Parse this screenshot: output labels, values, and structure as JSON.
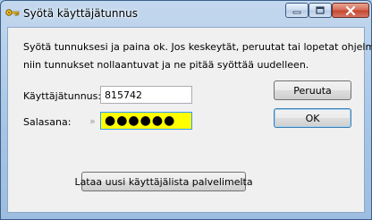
{
  "window": {
    "title": "Syötä käyttäjätunnus",
    "icon": "key-icon",
    "controls": {
      "minimize": "minimize-icon",
      "maximize": "maximize-icon",
      "close": "close-icon"
    }
  },
  "instructions": {
    "line1": "Syötä tunnuksesi ja paina ok. Jos keskeytät, peruutat tai lopetat ohjelman",
    "line2": "niin tunnukset nollaantuvat ja ne pitää syöttää uudelleen."
  },
  "form": {
    "username_label": "Käyttäjätunnus:",
    "username_value": "815742",
    "password_label": "Salasana:",
    "password_indicator": "»",
    "password_mask": "●●●●●●"
  },
  "buttons": {
    "cancel": "Peruuta",
    "ok": "OK",
    "reload": "Lataa uusi käyttäjälista palvelimelta"
  },
  "colors": {
    "password_background": "#ffff00",
    "focus_border": "#3399ff",
    "close_button": "#c3452a"
  }
}
